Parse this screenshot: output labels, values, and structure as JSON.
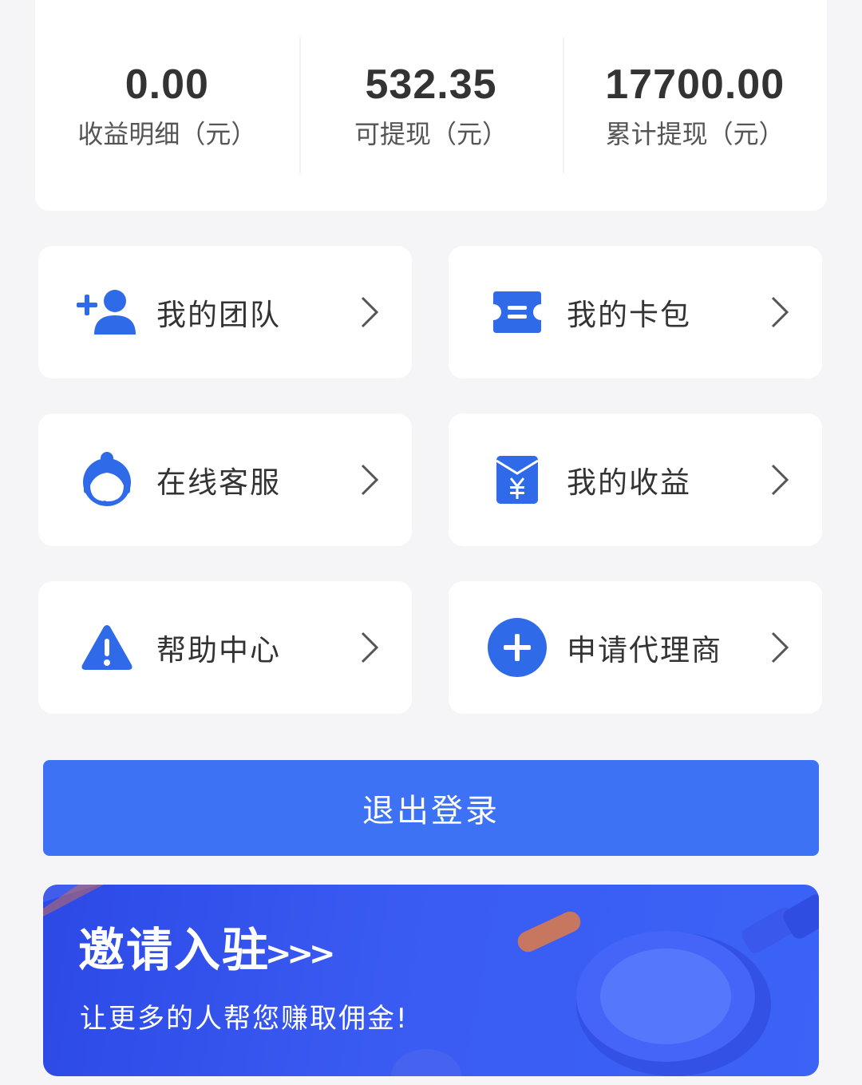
{
  "stats": [
    {
      "value": "0.00",
      "label": "收益明细（元）"
    },
    {
      "value": "532.35",
      "label": "可提现（元）"
    },
    {
      "value": "17700.00",
      "label": "累计提现（元）"
    }
  ],
  "menu": [
    {
      "label": "我的团队",
      "icon": "add-user-icon"
    },
    {
      "label": "我的卡包",
      "icon": "card-wallet-icon"
    },
    {
      "label": "在线客服",
      "icon": "customer-service-icon"
    },
    {
      "label": "我的收益",
      "icon": "yuan-envelope-icon"
    },
    {
      "label": "帮助中心",
      "icon": "warning-icon"
    },
    {
      "label": "申请代理商",
      "icon": "plus-circle-icon"
    }
  ],
  "logout": {
    "label": "退出登录"
  },
  "banner": {
    "title": "邀请入驻",
    "arrows": ">>>",
    "subtitle": "让更多的人帮您赚取佣金!"
  },
  "colors": {
    "accent": "#3d72f5",
    "icon": "#2f6ae8",
    "background": "#f5f5f7"
  }
}
